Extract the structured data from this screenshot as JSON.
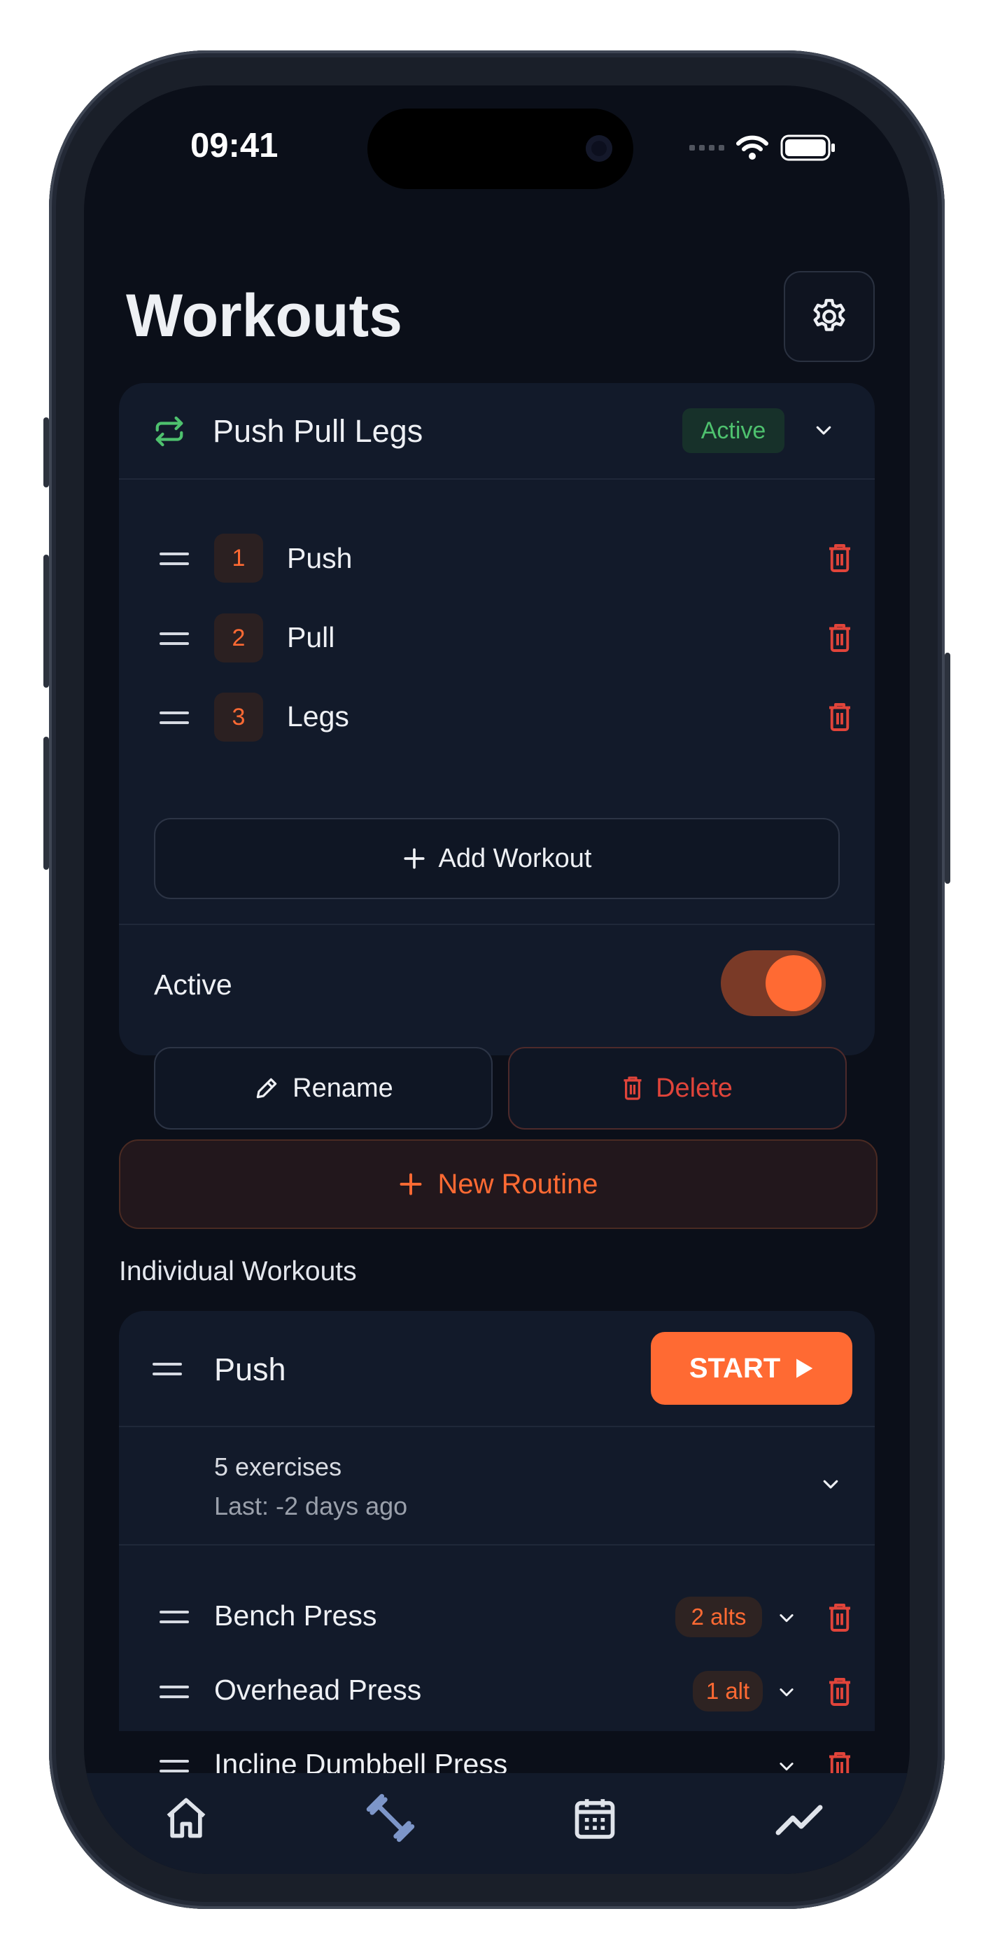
{
  "status": {
    "time": "09:41"
  },
  "header": {
    "title": "Workouts"
  },
  "routine": {
    "name": "Push Pull Legs",
    "status_badge": "Active",
    "workouts": [
      {
        "number": "1",
        "name": "Push"
      },
      {
        "number": "2",
        "name": "Pull"
      },
      {
        "number": "3",
        "name": "Legs"
      }
    ],
    "add_workout_label": "Add Workout",
    "active_label": "Active",
    "active_on": true,
    "rename_label": "Rename",
    "delete_label": "Delete"
  },
  "new_routine_label": "New Routine",
  "individual": {
    "section_label": "Individual Workouts",
    "workout": {
      "name": "Push",
      "start_label": "START",
      "exercise_count": "5 exercises",
      "last": "Last: -2 days ago",
      "exercises": [
        {
          "name": "Bench Press",
          "alts": "2 alts"
        },
        {
          "name": "Overhead Press",
          "alts": "1 alt"
        },
        {
          "name": "Incline Dumbbell Press",
          "alts": ""
        }
      ]
    }
  },
  "tabs": [
    {
      "icon": "home-icon"
    },
    {
      "icon": "dumbbell-icon"
    },
    {
      "icon": "calendar-icon"
    },
    {
      "icon": "chart-icon"
    }
  ],
  "colors": {
    "accent": "#ff6a33",
    "active_green": "#4ec16e",
    "background": "#0b0f19",
    "card": "#121a2a",
    "danger": "#e0443a"
  }
}
